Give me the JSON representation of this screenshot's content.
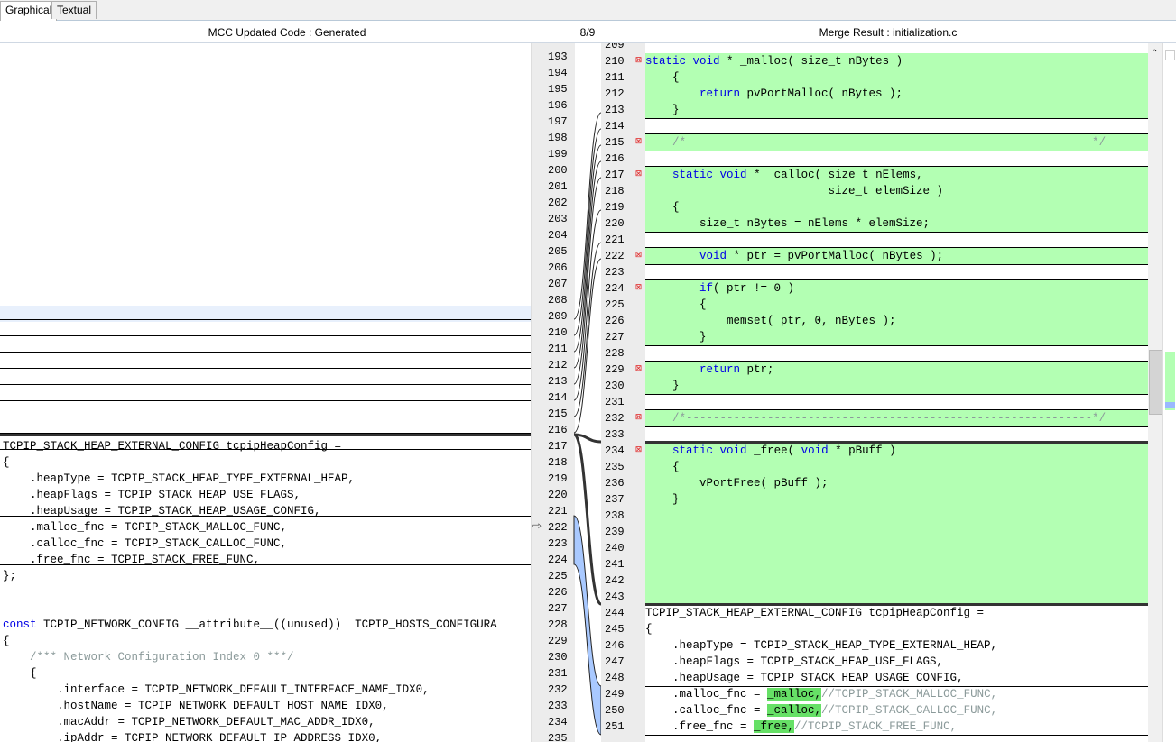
{
  "tabs": [
    {
      "label": "Graphical"
    },
    {
      "label": "Textual"
    }
  ],
  "header": {
    "left_title": "MCC Updated Code : Generated",
    "counter": "8/9",
    "right_title": "Merge Result : initialization.c"
  },
  "left": {
    "lines": [
      {
        "n": "193",
        "t": ""
      },
      {
        "n": "194",
        "t": ""
      },
      {
        "n": "195",
        "t": ""
      },
      {
        "n": "196",
        "t": ""
      },
      {
        "n": "197",
        "t": ""
      },
      {
        "n": "198",
        "t": ""
      },
      {
        "n": "199",
        "t": ""
      },
      {
        "n": "200",
        "t": ""
      },
      {
        "n": "201",
        "t": ""
      },
      {
        "n": "202",
        "t": ""
      },
      {
        "n": "203",
        "t": ""
      },
      {
        "n": "204",
        "t": ""
      },
      {
        "n": "205",
        "t": ""
      },
      {
        "n": "206",
        "t": ""
      },
      {
        "n": "207",
        "t": ""
      },
      {
        "n": "208",
        "t": ""
      },
      {
        "n": "209",
        "t": ""
      },
      {
        "n": "210",
        "t": ""
      },
      {
        "n": "211",
        "t": ""
      },
      {
        "n": "212",
        "t": ""
      },
      {
        "n": "213",
        "t": ""
      },
      {
        "n": "214",
        "t": ""
      },
      {
        "n": "215",
        "t": ""
      },
      {
        "n": "216",
        "t": ""
      },
      {
        "n": "217",
        "t": "TCPIP_STACK_HEAP_EXTERNAL_CONFIG tcpipHeapConfig ="
      },
      {
        "n": "218",
        "t": "{"
      },
      {
        "n": "219",
        "t": "    .heapType = TCPIP_STACK_HEAP_TYPE_EXTERNAL_HEAP,"
      },
      {
        "n": "220",
        "t": "    .heapFlags = TCPIP_STACK_HEAP_USE_FLAGS,"
      },
      {
        "n": "221",
        "t": "    .heapUsage = TCPIP_STACK_HEAP_USAGE_CONFIG,"
      },
      {
        "n": "222",
        "t": "    .malloc_fnc = TCPIP_STACK_MALLOC_FUNC,"
      },
      {
        "n": "223",
        "t": "    .calloc_fnc = TCPIP_STACK_CALLOC_FUNC,"
      },
      {
        "n": "224",
        "t": "    .free_fnc = TCPIP_STACK_FREE_FUNC,"
      },
      {
        "n": "225",
        "t": "};"
      },
      {
        "n": "226",
        "t": ""
      },
      {
        "n": "227",
        "t": ""
      },
      {
        "n": "228",
        "t": "const TCPIP_NETWORK_CONFIG __attribute__((unused))  TCPIP_HOSTS_CONFIGURA"
      },
      {
        "n": "229",
        "t": "{"
      },
      {
        "n": "230",
        "t": "    /*** Network Configuration Index 0 ***/"
      },
      {
        "n": "231",
        "t": "    {"
      },
      {
        "n": "232",
        "t": "        .interface = TCPIP_NETWORK_DEFAULT_INTERFACE_NAME_IDX0,"
      },
      {
        "n": "233",
        "t": "        .hostName = TCPIP_NETWORK_DEFAULT_HOST_NAME_IDX0,"
      },
      {
        "n": "234",
        "t": "        .macAddr = TCPIP_NETWORK_DEFAULT_MAC_ADDR_IDX0,"
      },
      {
        "n": "235",
        "t": "        .ipAddr = TCPIP_NETWORK_DEFAULT_IP_ADDRESS_IDX0,"
      }
    ]
  },
  "right": {
    "lines": [
      {
        "n": "209",
        "t": ""
      },
      {
        "n": "210",
        "t": "static void * _malloc( size_t nBytes )",
        "x": 1
      },
      {
        "n": "211",
        "t": "    {"
      },
      {
        "n": "212",
        "t": "        return pvPortMalloc( nBytes );"
      },
      {
        "n": "213",
        "t": "    }"
      },
      {
        "n": "214",
        "t": ""
      },
      {
        "n": "215",
        "t": "    /*------------------------------------------------------------*/",
        "x": 1
      },
      {
        "n": "216",
        "t": ""
      },
      {
        "n": "217",
        "t": "    static void * _calloc( size_t nElems,",
        "x": 1
      },
      {
        "n": "218",
        "t": "                           size_t elemSize )"
      },
      {
        "n": "219",
        "t": "    {"
      },
      {
        "n": "220",
        "t": "        size_t nBytes = nElems * elemSize;"
      },
      {
        "n": "221",
        "t": ""
      },
      {
        "n": "222",
        "t": "        void * ptr = pvPortMalloc( nBytes );",
        "x": 1
      },
      {
        "n": "223",
        "t": ""
      },
      {
        "n": "224",
        "t": "        if( ptr != 0 )",
        "x": 1
      },
      {
        "n": "225",
        "t": "        {"
      },
      {
        "n": "226",
        "t": "            memset( ptr, 0, nBytes );"
      },
      {
        "n": "227",
        "t": "        }"
      },
      {
        "n": "228",
        "t": ""
      },
      {
        "n": "229",
        "t": "        return ptr;",
        "x": 1
      },
      {
        "n": "230",
        "t": "    }"
      },
      {
        "n": "231",
        "t": ""
      },
      {
        "n": "232",
        "t": "    /*------------------------------------------------------------*/",
        "x": 1
      },
      {
        "n": "233",
        "t": ""
      },
      {
        "n": "234",
        "t": "    static void _free( void * pBuff )",
        "x": 1
      },
      {
        "n": "235",
        "t": "    {"
      },
      {
        "n": "236",
        "t": "        vPortFree( pBuff );"
      },
      {
        "n": "237",
        "t": "    }"
      },
      {
        "n": "238",
        "t": ""
      },
      {
        "n": "239",
        "t": ""
      },
      {
        "n": "240",
        "t": ""
      },
      {
        "n": "241",
        "t": ""
      },
      {
        "n": "242",
        "t": ""
      },
      {
        "n": "243",
        "t": ""
      },
      {
        "n": "244",
        "t": "TCPIP_STACK_HEAP_EXTERNAL_CONFIG tcpipHeapConfig ="
      },
      {
        "n": "245",
        "t": "{"
      },
      {
        "n": "246",
        "t": "    .heapType = TCPIP_STACK_HEAP_TYPE_EXTERNAL_HEAP,"
      },
      {
        "n": "247",
        "t": "    .heapFlags = TCPIP_STACK_HEAP_USE_FLAGS,"
      },
      {
        "n": "248",
        "t": "    .heapUsage = TCPIP_STACK_HEAP_USAGE_CONFIG,"
      },
      {
        "n": "249",
        "t": "    .malloc_fnc = ",
        "h": "_malloc,",
        "c": "//TCPIP_STACK_MALLOC_FUNC,"
      },
      {
        "n": "250",
        "t": "    .calloc_fnc = ",
        "h": "_calloc,",
        "c": "//TCPIP_STACK_CALLOC_FUNC,"
      },
      {
        "n": "251",
        "t": "    .free_fnc = ",
        "h": "_free,",
        "c": "//TCPIP_STACK_FREE_FUNC,"
      }
    ]
  },
  "colors": {
    "added": "#b3ffb3",
    "changed": "#66e066",
    "connector": "#a9c9ff"
  },
  "icons": {
    "nav_arrow": "⇨",
    "conflict": "⊠",
    "scroll_up": "⌃"
  }
}
